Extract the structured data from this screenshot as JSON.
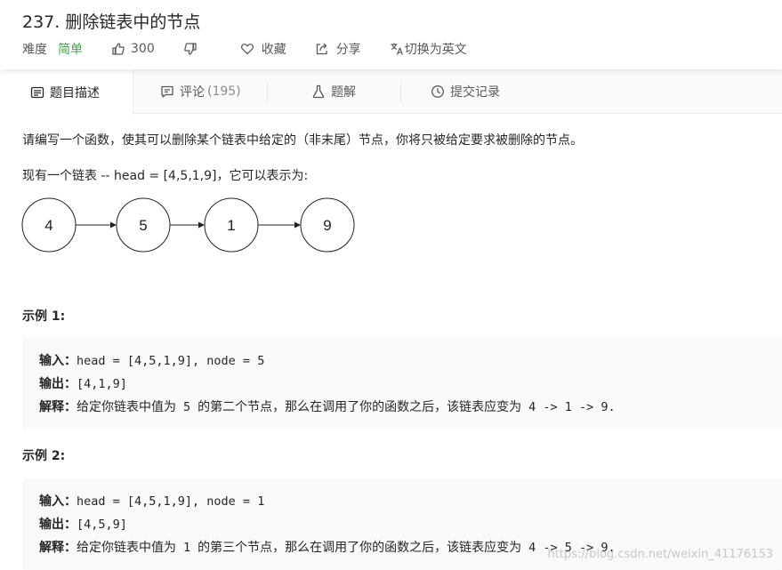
{
  "problem": {
    "title": "237. 删除链表中的节点",
    "difficulty_label": "难度",
    "difficulty_value": "简单",
    "like_count": "300",
    "collect_label": "收藏",
    "share_label": "分享",
    "switch_lang_label": "切换为英文"
  },
  "tabs": {
    "description": "题目描述",
    "comments": "评论",
    "comments_count": "(195)",
    "solution": "题解",
    "submissions": "提交记录"
  },
  "content": {
    "intro": "请编写一个函数，使其可以删除某个链表中给定的（非末尾）节点，你将只被给定要求被删除的节点。",
    "list_intro": "现有一个链表 -- head = [4,5,1,9]，它可以表示为:",
    "nodes": [
      "4",
      "5",
      "1",
      "9"
    ]
  },
  "examples": [
    {
      "title": "示例 1:",
      "input_label": "输入：",
      "input": "head = [4,5,1,9], node = 5",
      "output_label": "输出：",
      "output": "[4,1,9]",
      "explain_label": "解释：",
      "explain_a": "给定你链表中值为",
      "explain_val": "5",
      "explain_b": "的第二个节点，那么在调用了你的函数之后，该链表应变为",
      "explain_result": "4 -> 1 -> 9."
    },
    {
      "title": "示例 2:",
      "input_label": "输入：",
      "input": "head = [4,5,1,9], node = 1",
      "output_label": "输出：",
      "output": "[4,5,9]",
      "explain_label": "解释：",
      "explain_a": "给定你链表中值为",
      "explain_val": "1",
      "explain_b": "的第三个节点，那么在调用了你的函数之后，该链表应变为",
      "explain_result": "4 -> 5 -> 9."
    }
  ],
  "watermark": "https://blog.csdn.net/weixin_41176153",
  "colors": {
    "easy_green": "#43a047",
    "tab_bar_bg": "#fafafa",
    "example_bg": "#f7f9fa"
  },
  "icons": {
    "like": "thumbs-up-icon",
    "dislike": "thumbs-down-icon",
    "collect": "heart-icon",
    "share": "share-icon",
    "lang": "translate-icon",
    "description": "document-icon",
    "comments": "comment-icon",
    "solution": "flask-icon",
    "submissions": "clock-icon"
  }
}
